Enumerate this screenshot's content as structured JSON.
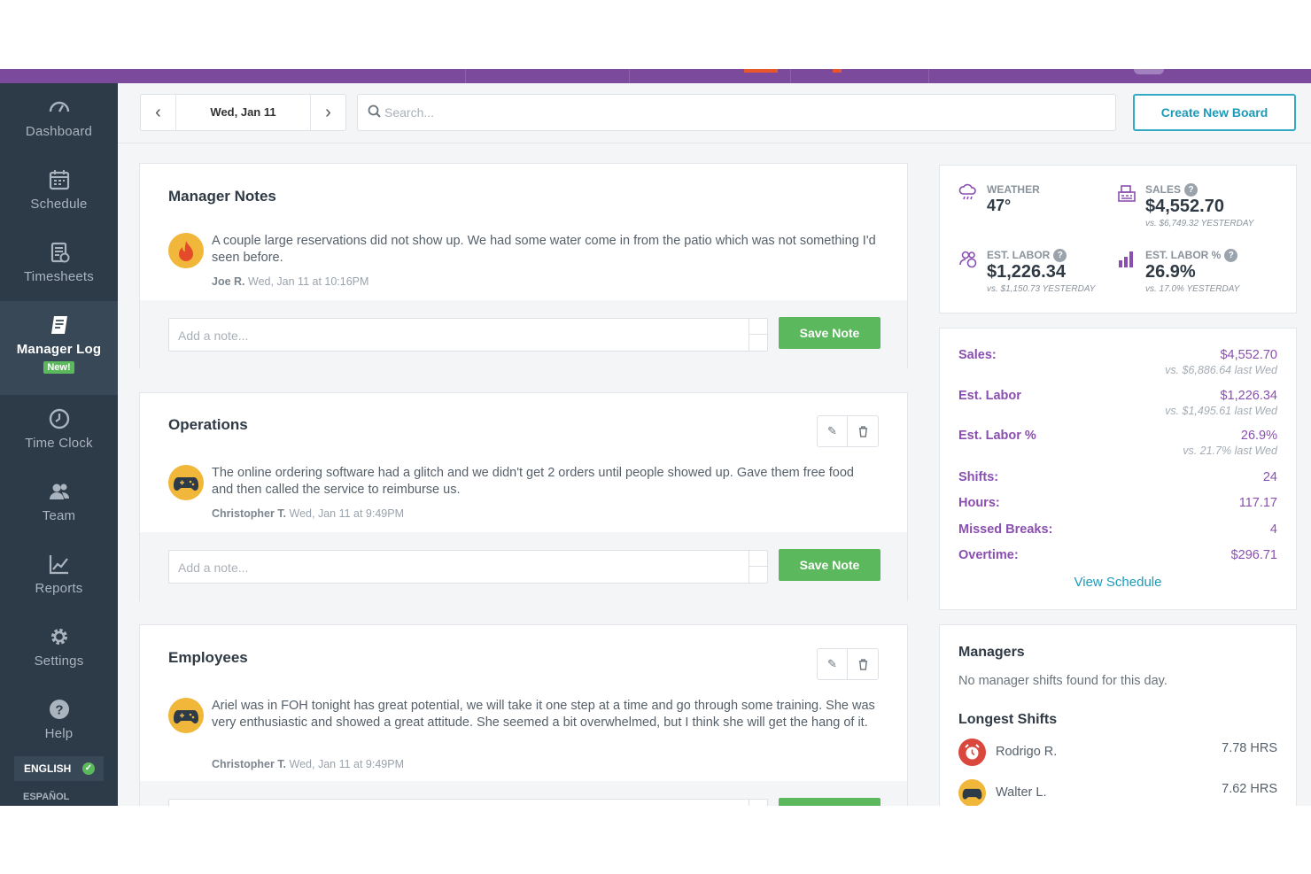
{
  "sidebar": {
    "items": [
      {
        "label": "Dashboard",
        "icon": "gauge-icon"
      },
      {
        "label": "Schedule",
        "icon": "calendar-icon"
      },
      {
        "label": "Timesheets",
        "icon": "timesheet-icon"
      },
      {
        "label": "Manager Log",
        "icon": "notebook-icon",
        "badge": "New!",
        "active": true
      },
      {
        "label": "Time Clock",
        "icon": "clock-icon"
      },
      {
        "label": "Team",
        "icon": "team-icon"
      },
      {
        "label": "Reports",
        "icon": "chart-icon"
      },
      {
        "label": "Settings",
        "icon": "gear-icon"
      },
      {
        "label": "Help",
        "icon": "help-icon"
      }
    ],
    "languages": {
      "active": "ENGLISH",
      "other": "ESPAÑOL"
    }
  },
  "toolbar": {
    "date": "Wed, Jan 11",
    "search_placeholder": "Search...",
    "create_button": "Create New Board"
  },
  "boards": [
    {
      "title": "Manager Notes",
      "note": {
        "text": "A couple large reservations did not show up. We had some water come in from the patio which was not something I'd seen before.",
        "author": "Joe R.",
        "time": "Wed, Jan 11 at 10:16PM",
        "avatar": "fire-avatar"
      },
      "input_placeholder": "Add a note...",
      "save_label": "Save Note"
    },
    {
      "title": "Operations",
      "note": {
        "text": "The online ordering software had a glitch and we didn't get 2 orders until people showed up. Gave them free food and then called the service to reimburse us.",
        "author": "Christopher T.",
        "time": "Wed, Jan 11 at 9:49PM",
        "avatar": "gamepad-avatar"
      },
      "input_placeholder": "Add a note...",
      "save_label": "Save Note"
    },
    {
      "title": "Employees",
      "note": {
        "text": "Ariel was in FOH tonight has great potential, we will take it one step at a time and go through some training. She was very enthusiastic and showed a great attitude. She seemed a bit overwhelmed, but I think she will get the hang of it.",
        "author": "Christopher T.",
        "time": "Wed, Jan 11 at 9:49PM",
        "avatar": "gamepad-avatar"
      }
    }
  ],
  "stats": {
    "weather": {
      "label": "WEATHER",
      "value": "47°"
    },
    "sales": {
      "label": "SALES",
      "value": "$4,552.70",
      "sub": "vs. $6,749.32 YESTERDAY"
    },
    "est_labor": {
      "label": "EST. LABOR",
      "value": "$1,226.34",
      "sub": "vs. $1,150.73 YESTERDAY"
    },
    "est_labor_pct": {
      "label": "EST. LABOR %",
      "value": "26.9%",
      "sub": "vs. 17.0% YESTERDAY"
    }
  },
  "summary": {
    "rows": [
      {
        "key": "Sales:",
        "value": "$4,552.70",
        "cmp": "vs. $6,886.64 last Wed"
      },
      {
        "key": "Est. Labor",
        "value": "$1,226.34",
        "cmp": "vs. $1,495.61 last Wed"
      },
      {
        "key": "Est. Labor %",
        "value": "26.9%",
        "cmp": "vs. 21.7% last Wed"
      },
      {
        "key": "Shifts:",
        "value": "24"
      },
      {
        "key": "Hours:",
        "value": "117.17"
      },
      {
        "key": "Missed Breaks:",
        "value": "4"
      },
      {
        "key": "Overtime:",
        "value": "$296.71"
      }
    ],
    "link": "View Schedule"
  },
  "managers": {
    "title": "Managers",
    "empty_text": "No manager shifts found for this day.",
    "longest_title": "Longest Shifts",
    "shifts": [
      {
        "name": "Rodrigo R.",
        "hours": "7.78 HRS",
        "avatar_color": "#d9473d"
      },
      {
        "name": "Walter L.",
        "hours": "7.62 HRS",
        "avatar_color": "#f0b73a"
      }
    ]
  },
  "colors": {
    "brand_purple": "#7b4a9c",
    "sidebar": "#2d3a47",
    "accent_green": "#5cb85c",
    "link_teal": "#1d9ab8",
    "stat_purple": "#8a4fb1"
  }
}
